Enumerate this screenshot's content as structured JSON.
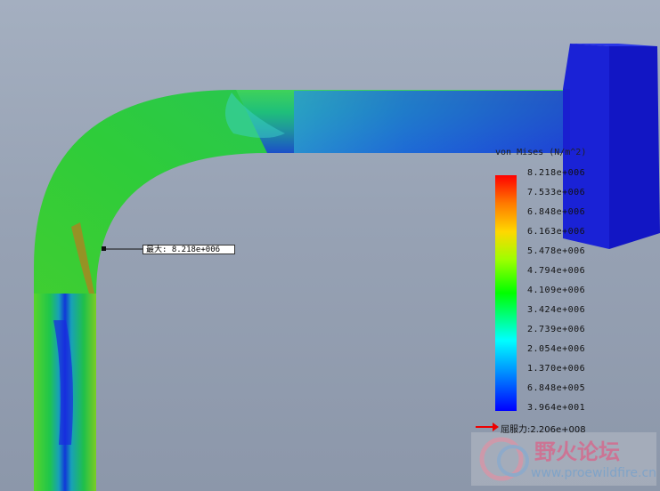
{
  "legend": {
    "title": "von Mises (N/m^2)",
    "values": [
      "8.218e+006",
      "7.533e+006",
      "6.848e+006",
      "6.163e+006",
      "5.478e+006",
      "4.794e+006",
      "4.109e+006",
      "3.424e+006",
      "2.739e+006",
      "2.054e+006",
      "1.370e+006",
      "6.848e+005",
      "3.964e+001"
    ]
  },
  "max_callout": {
    "label": "最大:",
    "value": "8.218e+006"
  },
  "yield": {
    "label": "屈服力:2.206e+008"
  },
  "watermark": {
    "name": "野火论坛",
    "url": "www.proewildfire.cn"
  },
  "colors": {
    "max": "#ff0000",
    "mid": "#00ff00",
    "min": "#0000ff",
    "fixture": "#1a22d6"
  }
}
